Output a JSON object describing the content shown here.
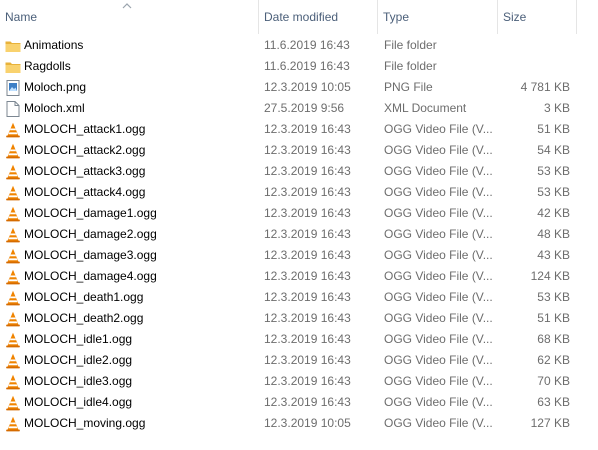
{
  "columns": {
    "name": "Name",
    "date_modified": "Date modified",
    "type": "Type",
    "size": "Size"
  },
  "sort": {
    "column": "name",
    "direction": "ascending"
  },
  "files": [
    {
      "icon": "folder-icon",
      "name": "Animations",
      "date": "11.6.2019 16:43",
      "type": "File folder",
      "size": ""
    },
    {
      "icon": "folder-icon",
      "name": "Ragdolls",
      "date": "11.6.2019 16:43",
      "type": "File folder",
      "size": ""
    },
    {
      "icon": "png-image-icon",
      "name": "Moloch.png",
      "date": "12.3.2019 10:05",
      "type": "PNG File",
      "size": "4 781 KB"
    },
    {
      "icon": "xml-file-icon",
      "name": "Moloch.xml",
      "date": "27.5.2019 9:56",
      "type": "XML Document",
      "size": "3 KB"
    },
    {
      "icon": "vlc-cone-icon",
      "name": "MOLOCH_attack1.ogg",
      "date": "12.3.2019 16:43",
      "type": "OGG Video File (V...",
      "size": "51 KB"
    },
    {
      "icon": "vlc-cone-icon",
      "name": "MOLOCH_attack2.ogg",
      "date": "12.3.2019 16:43",
      "type": "OGG Video File (V...",
      "size": "54 KB"
    },
    {
      "icon": "vlc-cone-icon",
      "name": "MOLOCH_attack3.ogg",
      "date": "12.3.2019 16:43",
      "type": "OGG Video File (V...",
      "size": "53 KB"
    },
    {
      "icon": "vlc-cone-icon",
      "name": "MOLOCH_attack4.ogg",
      "date": "12.3.2019 16:43",
      "type": "OGG Video File (V...",
      "size": "53 KB"
    },
    {
      "icon": "vlc-cone-icon",
      "name": "MOLOCH_damage1.ogg",
      "date": "12.3.2019 16:43",
      "type": "OGG Video File (V...",
      "size": "42 KB"
    },
    {
      "icon": "vlc-cone-icon",
      "name": "MOLOCH_damage2.ogg",
      "date": "12.3.2019 16:43",
      "type": "OGG Video File (V...",
      "size": "48 KB"
    },
    {
      "icon": "vlc-cone-icon",
      "name": "MOLOCH_damage3.ogg",
      "date": "12.3.2019 16:43",
      "type": "OGG Video File (V...",
      "size": "43 KB"
    },
    {
      "icon": "vlc-cone-icon",
      "name": "MOLOCH_damage4.ogg",
      "date": "12.3.2019 16:43",
      "type": "OGG Video File (V...",
      "size": "124 KB"
    },
    {
      "icon": "vlc-cone-icon",
      "name": "MOLOCH_death1.ogg",
      "date": "12.3.2019 16:43",
      "type": "OGG Video File (V...",
      "size": "53 KB"
    },
    {
      "icon": "vlc-cone-icon",
      "name": "MOLOCH_death2.ogg",
      "date": "12.3.2019 16:43",
      "type": "OGG Video File (V...",
      "size": "51 KB"
    },
    {
      "icon": "vlc-cone-icon",
      "name": "MOLOCH_idle1.ogg",
      "date": "12.3.2019 16:43",
      "type": "OGG Video File (V...",
      "size": "68 KB"
    },
    {
      "icon": "vlc-cone-icon",
      "name": "MOLOCH_idle2.ogg",
      "date": "12.3.2019 16:43",
      "type": "OGG Video File (V...",
      "size": "62 KB"
    },
    {
      "icon": "vlc-cone-icon",
      "name": "MOLOCH_idle3.ogg",
      "date": "12.3.2019 16:43",
      "type": "OGG Video File (V...",
      "size": "70 KB"
    },
    {
      "icon": "vlc-cone-icon",
      "name": "MOLOCH_idle4.ogg",
      "date": "12.3.2019 16:43",
      "type": "OGG Video File (V...",
      "size": "63 KB"
    },
    {
      "icon": "vlc-cone-icon",
      "name": "MOLOCH_moving.ogg",
      "date": "12.3.2019 10:05",
      "type": "OGG Video File (V...",
      "size": "127 KB"
    }
  ],
  "colors": {
    "header_text": "#4c607a",
    "secondary_text": "#6d6d6d",
    "folder": "#f7c84a",
    "vlc_orange": "#f08400"
  }
}
